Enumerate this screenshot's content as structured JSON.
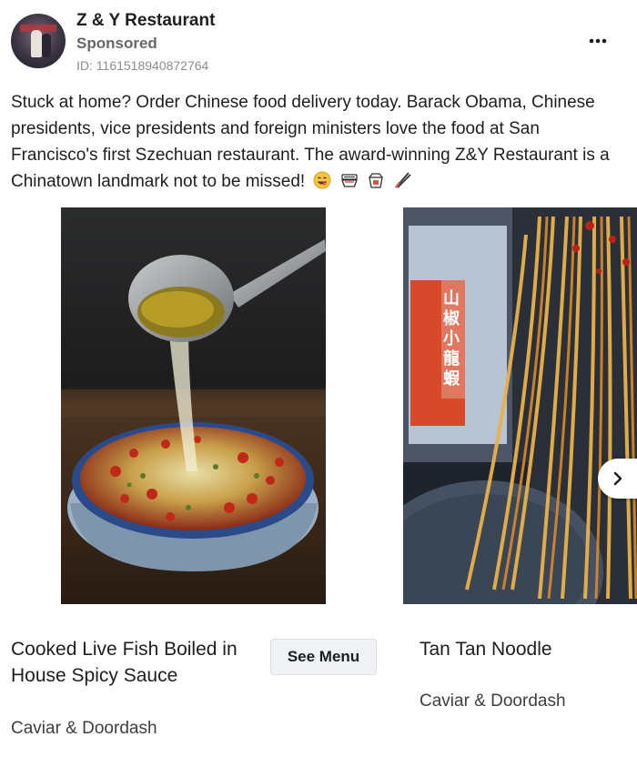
{
  "post": {
    "page_name": "Z & Y Restaurant",
    "sponsored_label": "Sponsored",
    "ad_id": "ID: 1161518940872764",
    "more_icon": "more-horizontal-icon",
    "body": "Stuck at home? Order Chinese food delivery today. Barack Obama, Chinese presidents, vice presidents and foreign ministers love the food at San Francisco's first Szechuan restaurant. The award-winning Z&Y Restaurant is a Chinatown landmark not to be missed!",
    "emojis": [
      "yum-face-icon",
      "noodle-bowl-icon",
      "takeout-box-icon",
      "chopsticks-icon"
    ]
  },
  "cards": [
    {
      "title": "Cooked Live Fish Boiled in House Spicy Sauce",
      "subtitle": "Caviar & Doordash",
      "cta": "See Menu"
    },
    {
      "title": "Tan Tan Noodle",
      "subtitle": "Caviar & Doordash",
      "sign_text": "山椒小龍蝦"
    }
  ],
  "colors": {
    "text": "#1c1e21",
    "secondary": "#65676b",
    "button_bg": "#f0f2f5"
  }
}
